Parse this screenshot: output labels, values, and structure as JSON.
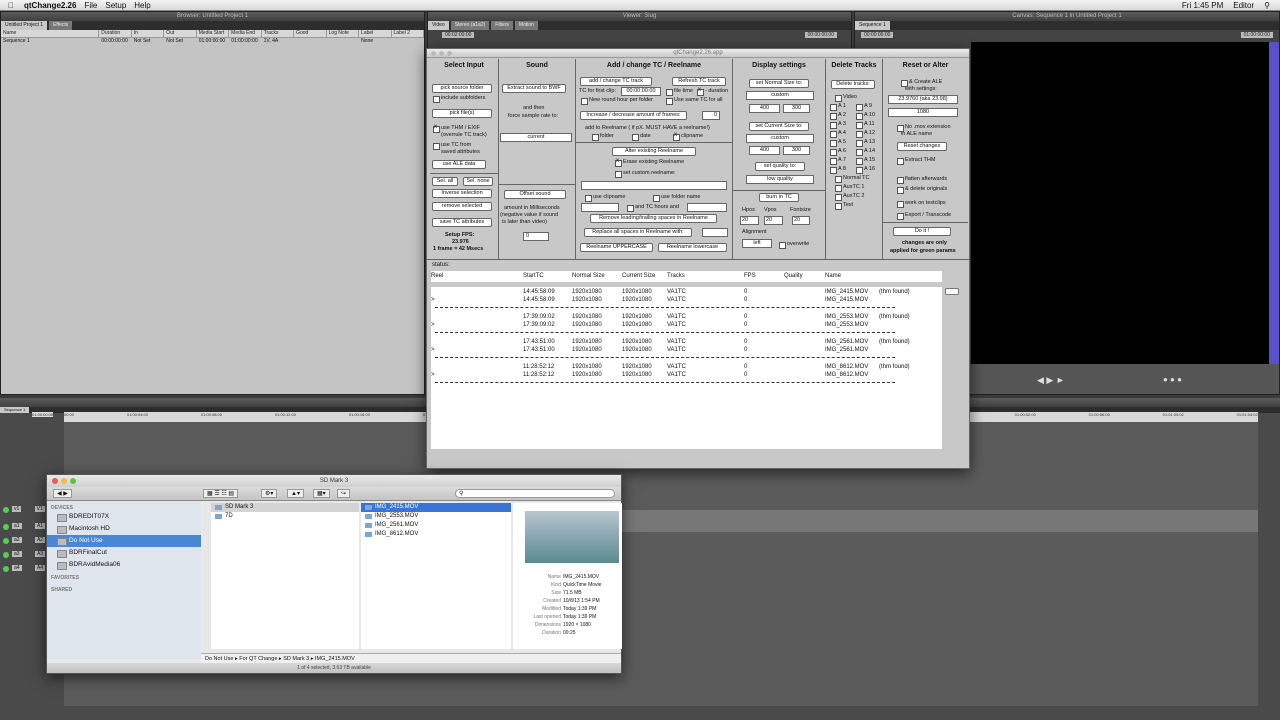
{
  "menubar": {
    "app": "qtChange2.26",
    "items": [
      "File",
      "Setup",
      "Help"
    ],
    "clock": "Fri 1:45 PM",
    "user": "Editor"
  },
  "fcp": {
    "browser_title": "Browser: Untitled Project 1",
    "browser_tabs": [
      "Untitled Project 1",
      "Effects"
    ],
    "browser_cols": [
      "Name",
      "Duration",
      "In",
      "Out",
      "Media Start",
      "Media End",
      "Tracks",
      "Good",
      "Log Note",
      "Label",
      "Label 2"
    ],
    "browser_row": [
      "Sequence 1",
      "00:00:00:00",
      "Not Set",
      "Not Set",
      "01:00:00:00",
      "01:00:00:00",
      "1V, 4A",
      "",
      "",
      "None",
      ""
    ],
    "viewer_title": "Viewer: Slug",
    "viewer_tabs": [
      "Video",
      "Stereo (a1a2)",
      "Filters",
      "Motion"
    ],
    "viewer_tc": [
      "00:02:00:00",
      "00:00:00:00"
    ],
    "canvas_title": "Canvas: Sequence 1 in Untitled Project 1",
    "canvas_tab": "Sequence 1",
    "canvas_tc": [
      "00:00:00:00",
      "01:00:00:00"
    ],
    "timeline_title": "Timeline: Sequence 1 in Untitled Project 1",
    "timeline_tab": "Sequence 1",
    "timeline_tc": "01:00:00:00",
    "ruler": [
      "00:00",
      "01:00:04:00",
      "01:00:08:00",
      "01:00:12:00",
      "01:00:16:00",
      "01:00:20:00",
      "01:00:24:00",
      "01:00:28:00",
      "01:00:32:00",
      "01:00:36:00",
      "01:00:40:00",
      "01:00:44:00",
      "01:00:48:00",
      "01:00:52:00",
      "01:00:56:00",
      "01:01:00:02",
      "01:01:04:02"
    ],
    "tracks": [
      {
        "a": "v1",
        "b": "V1"
      },
      {
        "a": "a1",
        "b": "A1"
      },
      {
        "a": "a2",
        "b": "A2"
      },
      {
        "a": "a3",
        "b": "A3"
      },
      {
        "a": "a4",
        "b": "A4"
      }
    ]
  },
  "qt": {
    "title": "qtChange2.26.app",
    "select_input": {
      "header": "Select Input",
      "pick_folder": "pick source folder",
      "include_sub": "include subfolders",
      "pick_files": "pick file(s)",
      "use_thm": "use THM / EXIF",
      "use_thm2": "(overrule TC track)",
      "use_tc_saved": "use TC from",
      "use_tc_saved2": "saved attributes",
      "use_ale": "use ALE  data",
      "sel_all": "Sel. all",
      "sel_none": "Sel. none",
      "inverse": "Inverse selection",
      "remove": "remove selected",
      "save_tc": "save TC attributes",
      "fps_label": "Setup FPS:",
      "fps_value": "23.976",
      "fps_frame": "1 frame = 42 Msecs"
    },
    "sound": {
      "header": "Sound",
      "extract": "Extract sound to BWF",
      "then": "and then",
      "force": "force sample rate to:",
      "current": "current",
      "offset": "Offset sound",
      "amount": "amount in Milliseconds",
      "neg": "(negative value if sound",
      "later": "is later than video)",
      "offset_val": "0"
    },
    "tc": {
      "header": "Add / change TC / Reelname",
      "add_tc": "add / change TC track",
      "refresh": "Refresh TC track",
      "first_clip": "TC for first clip:",
      "first_val": "00:00:00:00",
      "file_time": "file time",
      "duration": "- duration",
      "new_round": "New round hour per folder",
      "same_tc": "Use same TC for all",
      "inc_dec": "Increase / decrease amount of frames:",
      "inc_val": "0",
      "add_reel": "add to Reelname ( if pX. MUST HAVE a reelname!)",
      "folder": "folder",
      "date": "date",
      "clipname": "clipname",
      "alter_reel": "Alter existing Reelname",
      "erase": "Erase existing Reelname",
      "custom": "set custom reelname:",
      "use_clip": "use clipname",
      "use_folder": "use folder name",
      "hours": "and TC hours and",
      "remove_spaces": "Remove leading/trailing spaces in Reelname",
      "replace": "Replace all spaces in Reelname with:",
      "upper": "Reelname UPPERCASE",
      "lower": "Reelname lowercase"
    },
    "display": {
      "header": "Display settings",
      "normal": "set Normal Size to:",
      "custom": "custom",
      "w1": "400",
      "h1": "300",
      "current": "set Current Size to:",
      "custom2": "custom",
      "w2": "400",
      "h2": "300",
      "quality": "set quality to:",
      "low": "low quality",
      "burn": "burn in TC",
      "hpos": "Hpos",
      "vpos": "Vpos",
      "fontsize": "Fontsize",
      "hv": "20",
      "vv": "20",
      "fv": "20",
      "alignment": "Alignment",
      "left": "left",
      "overwrite": "overwrite"
    },
    "delete": {
      "header": "Delete Tracks",
      "btn": "Delete tracks:",
      "video": "Video",
      "a_left": [
        "A 1",
        "A 2",
        "A 3",
        "A 4",
        "A 5",
        "A 6",
        "A 7",
        "A 8"
      ],
      "a_right": [
        "A 9",
        "A 10",
        "A 11",
        "A 12",
        "A 13",
        "A 14",
        "A 15",
        "A 16"
      ],
      "normal_tc": "Normal TC",
      "auxtc1": "AuxTC 1",
      "auxtc2": "AuxTC 2",
      "text": "Text"
    },
    "reset": {
      "header": "Reset or Alter",
      "create_ale": "& Create ALE",
      "with_settings": "with settings:",
      "fps_sel": "23.9760 (aka 23.98)",
      "res": "1080",
      "no_mov": "No .mov extension",
      "in_ale": "in ALE name",
      "reset": "Reset  changes",
      "extract_thm": "Extract THM",
      "flatten": "flatten afterwards",
      "delete_orig": "& delete originals",
      "work": "work on testclips",
      "export": "Export / Transcode",
      "doit": "Do it !",
      "note1": "changes are only",
      "note2": "applied for green params"
    },
    "status": "status:",
    "list_cols": [
      "Reel",
      "StartTC",
      "Normal Size",
      "Current Size",
      "Tracks",
      "FPS",
      "Quality",
      "Name"
    ],
    "rows": [
      {
        "start": "14:45:58:09",
        "normal": "1920x1080",
        "current": "1920x1080",
        "tracks": "VA1TC",
        "fps": "0",
        "name": "IMG_2415.MOV",
        "thm": "(thm found)"
      },
      {
        "start": "17:39:09:02",
        "normal": "1920x1080",
        "current": "1920x1080",
        "tracks": "VA1TC",
        "fps": "0",
        "name": "IMG_2553.MOV",
        "thm": "(thm found)"
      },
      {
        "start": "17:43:51:00",
        "normal": "1920x1080",
        "current": "1920x1080",
        "tracks": "VA1TC",
        "fps": "0",
        "name": "IMG_2561.MOV",
        "thm": "(thm found)"
      },
      {
        "start": "11:28:52:12",
        "normal": "1920x1080",
        "current": "1920x1080",
        "tracks": "VA1TC",
        "fps": "0",
        "name": "IMG_8612.MOV",
        "thm": "(thm found)"
      }
    ],
    "arrow": ">"
  },
  "finder": {
    "title": "SD Mark 3",
    "devices_label": "DEVICES",
    "devices": [
      "BDREDIT07X",
      "Macintosh HD",
      "Do Not Use",
      "BDRFinalCut",
      "BDRAvidMedia06"
    ],
    "favorites": "FAVORITES",
    "shared": "SHARED",
    "colA": [
      "SD Mark 3",
      "7D"
    ],
    "colB": [
      "IMG_2415.MOV",
      "IMG_2553.MOV",
      "IMG_2561.MOV",
      "IMG_8612.MOV"
    ],
    "meta": [
      [
        "Name",
        "IMG_2415.MOV"
      ],
      [
        "Kind",
        "QuickTime Movie"
      ],
      [
        "Size",
        "71.5 MB"
      ],
      [
        "Created",
        "10/8/13 1:54 PM"
      ],
      [
        "Modified",
        "Today 1:39 PM"
      ],
      [
        "Last opened",
        "Today 1:39 PM"
      ],
      [
        "Dimensions",
        "1920 × 1080"
      ],
      [
        "Duration",
        "00:25"
      ]
    ],
    "path": [
      "Do Not Use",
      "For QT Change",
      "SD Mark 3",
      "IMG_2415.MOV"
    ],
    "status": "1 of 4 selected, 3.63 TB available"
  }
}
